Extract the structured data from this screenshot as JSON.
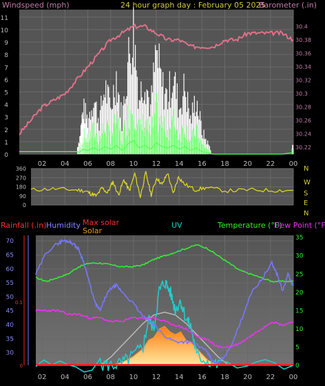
{
  "panels": {
    "top": {
      "title_left": "Windspeed (mph)",
      "title_center": "24 hour graph day : February 05 2025",
      "title_right": "Barometer (.in)"
    },
    "bottom": {
      "labels": {
        "rainfall": "Rainfall (.in)",
        "humidity": "Humidity",
        "max_solar": "Max solar",
        "solar": "Solar",
        "uv": "UV",
        "temperature": "Temperature (°F)",
        "dew_point": "Dew Point (°F)"
      }
    }
  },
  "colors": {
    "wind_gust": "#ffffff",
    "wind_avg": "#55ff55",
    "barometer": "#e0708a",
    "direction": "#e6dd20",
    "humidity": "#7777ff",
    "temperature": "#33ee33",
    "dew_point": "#ee33ee",
    "uv": "#22cccc",
    "solar": "#ff9922",
    "max_solar": "#bbbbbb",
    "rainfall": "#ff2020"
  },
  "chart_data": [
    {
      "type": "line",
      "series": [
        {
          "name": "Windspeed (mph)",
          "axis": "left",
          "x": [
            0,
            1,
            2,
            3,
            4,
            5,
            5.3,
            5.6,
            6,
            6.5,
            7,
            7.5,
            8,
            8.5,
            9,
            9.5,
            10,
            10.5,
            11,
            11.5,
            12,
            12.5,
            13,
            13.5,
            14,
            14.5,
            15,
            15.5,
            16,
            16.5,
            17,
            18,
            19,
            20,
            21,
            22,
            23,
            23.8,
            24
          ],
          "values": [
            0.2,
            0.2,
            0.2,
            0.2,
            0.2,
            0.2,
            1.5,
            4,
            3,
            5,
            3,
            6,
            4,
            7,
            3,
            8,
            11,
            5,
            7,
            4,
            9,
            6,
            5,
            7,
            4,
            6,
            3,
            5,
            2,
            1,
            0,
            0,
            0,
            0,
            0,
            0,
            0,
            0.1,
            1
          ]
        },
        {
          "name": "Barometer (.in)",
          "axis": "right",
          "x": [
            0,
            1,
            2,
            3,
            4,
            5,
            6,
            7,
            8,
            9,
            10,
            11,
            12,
            13,
            14,
            15,
            16,
            17,
            18,
            19,
            20,
            21,
            22,
            23,
            24
          ],
          "values": [
            30.24,
            30.26,
            30.28,
            30.29,
            30.3,
            30.32,
            30.34,
            30.36,
            30.38,
            30.39,
            30.4,
            30.4,
            30.39,
            30.38,
            30.38,
            30.37,
            30.37,
            30.37,
            30.38,
            30.38,
            30.39,
            30.39,
            30.39,
            30.39,
            30.38
          ]
        }
      ],
      "xlabel": "",
      "ylabel_left": "Windspeed (mph)",
      "ylabel_right": "Barometer (.in)",
      "x_ticks": [
        "02",
        "04",
        "06",
        "08",
        "10",
        "12",
        "14",
        "16",
        "18",
        "20",
        "22",
        "00"
      ],
      "y_left_ticks": [
        0,
        1,
        2,
        3,
        4,
        5,
        6,
        7,
        8,
        9,
        10,
        11
      ],
      "y_right_ticks": [
        30.22,
        30.24,
        30.26,
        30.28,
        30.3,
        30.32,
        30.34,
        30.36,
        30.38,
        30.4
      ],
      "ylim_left": [
        0,
        11.6
      ],
      "ylim_right": [
        30.21,
        30.425
      ],
      "grid": true
    },
    {
      "type": "line",
      "series": [
        {
          "name": "Wind direction",
          "x": [
            0,
            2,
            4,
            5,
            5.5,
            6,
            6.5,
            7,
            7.5,
            8,
            8.5,
            9,
            9.5,
            10,
            10.5,
            11,
            11.5,
            12,
            12.5,
            13,
            13.5,
            14,
            15,
            16,
            18,
            20,
            22,
            24
          ],
          "values": [
            150,
            160,
            150,
            140,
            110,
            90,
            170,
            120,
            230,
            100,
            250,
            140,
            310,
            80,
            320,
            100,
            270,
            200,
            320,
            110,
            280,
            210,
            150,
            170,
            140,
            150,
            145,
            145
          ]
        }
      ],
      "y_ticks": [
        0,
        90,
        180,
        270,
        360
      ],
      "y_tick_labels": [
        "0",
        "90",
        "180",
        "270",
        "360"
      ],
      "compass": [
        "N",
        "W",
        "S",
        "E",
        "N"
      ],
      "ylim": [
        0,
        360
      ],
      "grid": true
    },
    {
      "type": "line",
      "series": [
        {
          "name": "Humidity",
          "axis": "humidity",
          "x": [
            0,
            1,
            2,
            2.5,
            3,
            3.5,
            4,
            4.5,
            5,
            5.5,
            6,
            6.5,
            7,
            7.5,
            8,
            9,
            10,
            11,
            12,
            13,
            14,
            15,
            16,
            16.5,
            17,
            18,
            19,
            20,
            21,
            22,
            22.5,
            23,
            23.5,
            24
          ],
          "values": [
            58,
            66,
            69,
            70,
            70,
            69,
            67,
            62,
            55,
            48,
            45,
            50,
            53,
            54,
            52,
            48,
            43,
            40,
            36,
            34,
            34,
            33,
            30,
            27,
            26,
            31,
            40,
            51,
            56,
            62,
            58,
            52,
            58,
            54
          ]
        },
        {
          "name": "Temperature (°F)",
          "axis": "temperature",
          "x": [
            0,
            1,
            2,
            3,
            4,
            5,
            6,
            7,
            8,
            9,
            10,
            11,
            12,
            13,
            14,
            15,
            16,
            17,
            18,
            19,
            20,
            21,
            22,
            23,
            24
          ],
          "values": [
            24,
            23,
            24,
            25,
            27,
            28,
            28,
            27.5,
            27,
            27,
            27.5,
            29,
            30,
            31,
            32,
            33,
            32,
            30,
            28,
            26,
            25,
            24,
            23,
            23,
            23
          ]
        },
        {
          "name": "Dew Point (°F)",
          "axis": "temperature",
          "x": [
            0,
            1,
            2,
            3,
            4,
            5,
            6,
            7,
            8,
            9,
            10,
            11,
            12,
            13,
            14,
            15,
            16,
            17,
            18,
            19,
            20,
            21,
            22,
            23,
            24
          ],
          "values": [
            15,
            15,
            15,
            14,
            14,
            13,
            13,
            12,
            12,
            13,
            13,
            13,
            12,
            11,
            10,
            8,
            7,
            5,
            5,
            6,
            8,
            10,
            12,
            11,
            12
          ]
        },
        {
          "name": "UV",
          "axis": "uv",
          "x": [
            0,
            6,
            7,
            8,
            9,
            10,
            10.5,
            11,
            11.5,
            12,
            12.5,
            13,
            13.5,
            14,
            14.5,
            15,
            16,
            17,
            24
          ],
          "values": [
            0,
            0,
            0,
            0.2,
            1,
            2,
            5,
            4,
            8,
            9,
            8,
            6,
            7,
            5,
            4,
            1,
            0.5,
            0,
            0
          ]
        },
        {
          "name": "Solar",
          "axis": "humidity",
          "x": [
            0,
            6.5,
            7,
            8,
            9,
            10,
            10.5,
            11,
            11.5,
            12,
            12.5,
            13,
            13.5,
            14,
            14.5,
            15,
            15.5,
            16,
            16.5,
            17,
            24
          ],
          "values": [
            0,
            0,
            0.1,
            1,
            3,
            6,
            9,
            10,
            13,
            14,
            12,
            11,
            12,
            9,
            8,
            6,
            4,
            2,
            1,
            0,
            0
          ]
        },
        {
          "name": "Max solar",
          "axis": "humidity",
          "x": [
            6,
            7,
            8,
            9,
            10,
            11,
            12,
            13,
            14,
            15,
            16,
            17,
            18
          ],
          "values": [
            0,
            3,
            7,
            11,
            15,
            18,
            19,
            18,
            15,
            11,
            7,
            3,
            0
          ]
        },
        {
          "name": "Rainfall (.in)",
          "axis": "rain",
          "x": [
            0,
            24
          ],
          "values": [
            0,
            0
          ]
        }
      ],
      "x_ticks": [
        "02",
        "04",
        "06",
        "08",
        "10",
        "12",
        "14",
        "16",
        "18",
        "20",
        "22",
        "00"
      ],
      "humidity_ticks": [
        30,
        35,
        40,
        45,
        50,
        55,
        60,
        65,
        70
      ],
      "temperature_ticks": [
        0,
        5,
        10,
        15,
        20,
        25,
        30,
        35
      ],
      "rain_ticks": [
        "0",
        "0.1"
      ],
      "ylim_humidity": [
        25.5,
        72
      ],
      "ylim_temperature": [
        0,
        35.6
      ],
      "grid": true
    }
  ]
}
